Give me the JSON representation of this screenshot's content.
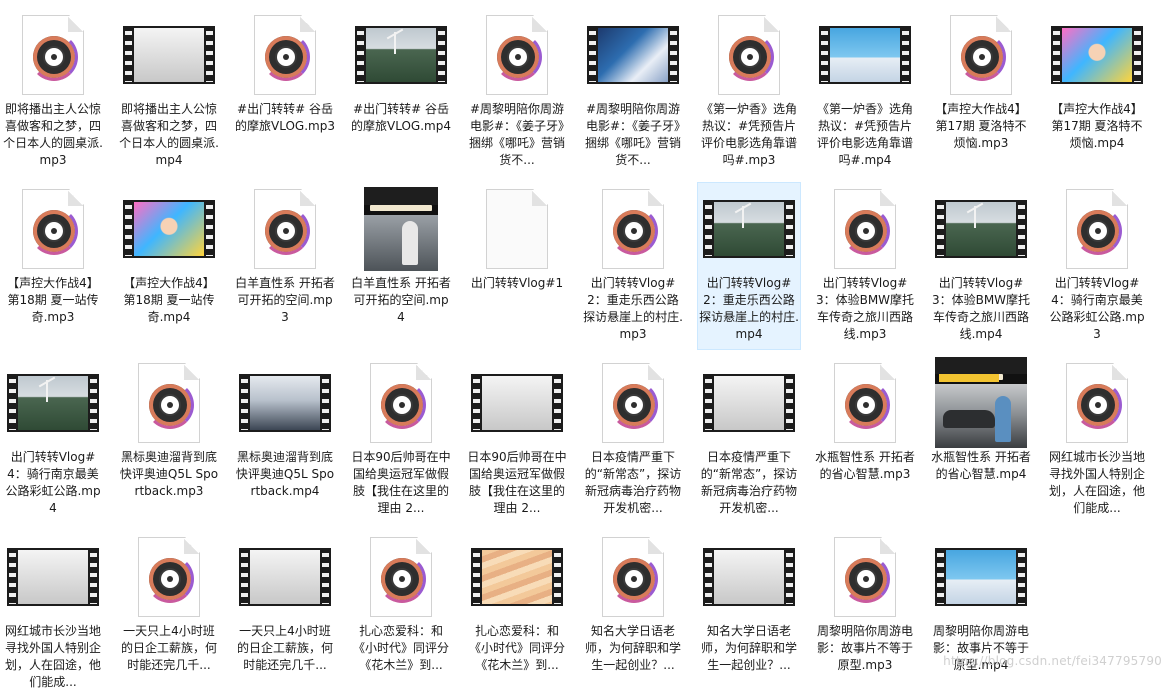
{
  "files": [
    {
      "name": "即将播出主人公惊喜做客和之梦，四个日本人的圆桌派.mp3",
      "kind": "mp3"
    },
    {
      "name": "即将播出主人公惊喜做客和之梦，四个日本人的圆桌派.mp4",
      "kind": "mp4",
      "thumb": "gray"
    },
    {
      "name": "#出门转转# 谷岳的摩旅VLOG.mp3",
      "kind": "mp3"
    },
    {
      "name": "#出门转转# 谷岳的摩旅VLOG.mp4",
      "kind": "mp4",
      "thumb": "landscape"
    },
    {
      "name": "#周黎明陪你周游电影#：《姜子牙》捆绑《哪吒》营销货不...",
      "kind": "mp3"
    },
    {
      "name": "#周黎明陪你周游电影#：《姜子牙》捆绑《哪吒》营销货不...",
      "kind": "mp4",
      "thumb": "studio"
    },
    {
      "name": "《第一炉香》选角热议：#凭预告片评价电影选角靠谱吗#.mp3",
      "kind": "mp3"
    },
    {
      "name": "《第一炉香》选角热议：#凭预告片评价电影选角靠谱吗#.mp4",
      "kind": "mp4",
      "thumb": "news"
    },
    {
      "name": "【声控大作战4】第17期 夏洛特不烦恼.mp3",
      "kind": "mp3"
    },
    {
      "name": "【声控大作战4】第17期 夏洛特不烦恼.mp4",
      "kind": "mp4",
      "thumb": "party"
    },
    {
      "name": "【声控大作战4】第18期 夏一站传奇.mp3",
      "kind": "mp3"
    },
    {
      "name": "【声控大作战4】第18期 夏一站传奇.mp4",
      "kind": "mp4",
      "thumb": "party"
    },
    {
      "name": "白羊直性系 开拓者可开拓的空间.mp3",
      "kind": "mp3"
    },
    {
      "name": "白羊直性系 开拓者可开拓的空间.mp4",
      "kind": "still"
    },
    {
      "name": "出门转转Vlog#1",
      "kind": "blank"
    },
    {
      "name": "出门转转Vlog#2：重走乐西公路探访悬崖上的村庄.mp3",
      "kind": "mp3"
    },
    {
      "name": "出门转转Vlog#2：重走乐西公路探访悬崖上的村庄.mp4",
      "kind": "mp4",
      "thumb": "landscape",
      "selected": true
    },
    {
      "name": "出门转转Vlog#3：体验BMW摩托车传奇之旅川西路线.mp3",
      "kind": "mp3"
    },
    {
      "name": "出门转转Vlog#3：体验BMW摩托车传奇之旅川西路线.mp4",
      "kind": "mp4",
      "thumb": "landscape"
    },
    {
      "name": "出门转转Vlog#4：骑行南京最美公路彩虹公路.mp3",
      "kind": "mp3"
    },
    {
      "name": "出门转转Vlog#4：骑行南京最美公路彩虹公路.mp4",
      "kind": "mp4",
      "thumb": "landscape"
    },
    {
      "name": "黑标奥迪溜背到底 快评奥迪Q5L Sportback.mp3",
      "kind": "mp3"
    },
    {
      "name": "黑标奥迪溜背到底 快评奥迪Q5L Sportback.mp4",
      "kind": "mp4",
      "thumb": "expo"
    },
    {
      "name": "日本90后帅哥在中国给奥运冠军做假肢【我住在这里的理由 2...",
      "kind": "mp3"
    },
    {
      "name": "日本90后帅哥在中国给奥运冠军做假肢【我住在这里的理由 2...",
      "kind": "mp4",
      "thumb": "gray"
    },
    {
      "name": "日本疫情严重下的“新常态”，探访新冠病毒治疗药物开发机密...",
      "kind": "mp3"
    },
    {
      "name": "日本疫情严重下的“新常态”，探访新冠病毒治疗药物开发机密...",
      "kind": "mp4",
      "thumb": "gray"
    },
    {
      "name": "水瓶智性系 开拓者的省心智慧.mp3",
      "kind": "mp3"
    },
    {
      "name": "水瓶智性系 开拓者的省心智慧.mp4",
      "kind": "stillwide"
    },
    {
      "name": "网红城市长沙当地寻找外国人特别企划，人在囧途，他们能成...",
      "kind": "mp3"
    },
    {
      "name": "网红城市长沙当地寻找外国人特别企划，人在囧途，他们能成...",
      "kind": "mp4",
      "thumb": "gray"
    },
    {
      "name": "一天只上4小时班的日企工薪族，何时能还完几千...",
      "kind": "mp3"
    },
    {
      "name": "一天只上4小时班的日企工薪族，何时能还完几千...",
      "kind": "mp4",
      "thumb": "gray"
    },
    {
      "name": "扎心恋爱科：和《小时代》同评分 《花木兰》到...",
      "kind": "mp3"
    },
    {
      "name": "扎心恋爱科：和《小时代》同评分 《花木兰》到...",
      "kind": "mp4",
      "thumb": "stripes"
    },
    {
      "name": "知名大学日语老师，为何辞职和学生一起创业？...",
      "kind": "mp3"
    },
    {
      "name": "知名大学日语老师，为何辞职和学生一起创业？...",
      "kind": "mp4",
      "thumb": "gray"
    },
    {
      "name": "周黎明陪你周游电影：故事片不等于原型.mp3",
      "kind": "mp3"
    },
    {
      "name": "周黎明陪你周游电影：故事片不等于原型.mp4",
      "kind": "mp4",
      "thumb": "news"
    }
  ],
  "watermark": "https://blog.csdn.net/fei347795790",
  "colors": {
    "selected_bg": "#e5f3ff",
    "selected_border": "#cce8ff"
  }
}
